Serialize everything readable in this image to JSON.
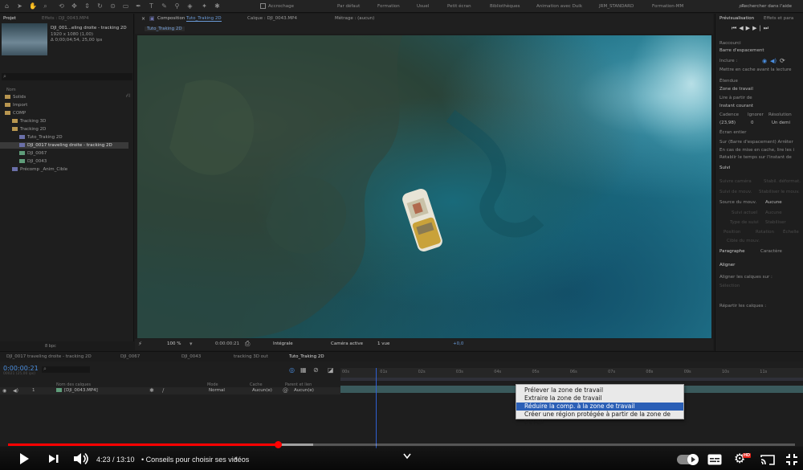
{
  "toolbar": {
    "snap_label": "Accrochage",
    "workspaces": [
      "Par défaut",
      "Formation",
      "Usuel",
      "Petit écran",
      "Bibliothèques",
      "Animation avec Duik",
      "JRM_STANDARD",
      "Formation-MM"
    ],
    "search_help": "Rechercher dans l'aide"
  },
  "project": {
    "tab_project": "Projet",
    "tab_effects": "Effets : DJI_0043.MP4",
    "selected_name": "DJI_001...eling droite - tracking 2D",
    "selected_dims": "1920 x 1080 (1,00)",
    "selected_duration": "Δ 0;00;04;54, 25,00 ips",
    "column_name": "Nom",
    "items": [
      {
        "label": "Solids",
        "kind": "folder",
        "indent": 0
      },
      {
        "label": "Import",
        "kind": "folder",
        "indent": 0
      },
      {
        "label": "COMP",
        "kind": "folder",
        "indent": 0
      },
      {
        "label": "Tracking 3D",
        "kind": "folder",
        "indent": 1
      },
      {
        "label": "Tracking 2D",
        "kind": "folder",
        "indent": 1
      },
      {
        "label": "Tuto_Traking 2D",
        "kind": "comp",
        "indent": 2
      },
      {
        "label": "DJI_0017 traveling droite - tracking 2D",
        "kind": "comp",
        "indent": 2
      },
      {
        "label": "DJI_0067",
        "kind": "footage",
        "indent": 2
      },
      {
        "label": "DJI_0043",
        "kind": "footage",
        "indent": 2
      },
      {
        "label": "Précomp _Anim_Cible",
        "kind": "comp",
        "indent": 1
      }
    ],
    "bpc": "8 bpc"
  },
  "viewer": {
    "tab_composition": "Composition",
    "tab_composition_name": "Tuto_Traking 2D",
    "tab_layer": "Calque : DJI_0043.MP4",
    "tab_footage": "Métrage : (aucun)",
    "breadcrumb": "Tuto_Traking 2D",
    "zoom": "100 %",
    "timecode": "0:00:00:21",
    "resolution": "Intégrale",
    "camera": "Caméra active",
    "views": "1 vue",
    "exposure": "+0,0"
  },
  "right": {
    "preview_tab": "Prévisualisation",
    "effects_tab": "Effets et para",
    "shortcut_label": "Raccourci",
    "shortcut_value": "Barre d'espacement",
    "include_label": "Inclure :",
    "cache_label": "Mettre en cache avant la lecture",
    "range_label": "Étendue",
    "range_value": "Zone de travail",
    "play_from_label": "Lire à partir de",
    "play_from_value": "Instant courant",
    "fps_label": "Cadence",
    "skip_label": "Ignorer",
    "res_label": "Résolution",
    "fps_value": "(23,98)",
    "skip_value": "0",
    "res_value": "Un demi",
    "fullscreen_label": "Écran entier",
    "stop_label": "Sur (Barre d'espacement) Arrêter",
    "stop_cache": "En cas de mise en cache, lire les i",
    "stop_time": "Rétablir le temps sur l'instant de",
    "track_tab": "Suivi",
    "track_camera": "Suivre caméra",
    "stab_warp": "Stabil. déformat.",
    "track_motion": "Suivi de mouv.",
    "stab_motion": "Stabiliser le mouv.",
    "motion_source_label": "Source du mouv.",
    "motion_source_value": "Aucune",
    "current_track": "Suivi actuel",
    "current_track_value": "Aucune",
    "track_type": "Type de suivi",
    "track_type_value": "Stabiliser",
    "opt_position": "Position",
    "opt_rotation": "Rotation",
    "opt_scale": "Échelle",
    "motion_target": "Cible du mouv.",
    "paragraph_tab": "Paragraphe",
    "character_tab": "Caractère",
    "align_tab": "Aligner",
    "align_layers_label": "Aligner les calques sur :",
    "align_selection": "Sélection",
    "distribute_label": "Répartir les calques :"
  },
  "timeline": {
    "tabs": [
      "DJI_0017 traveling droite - tracking 2D",
      "DJI_0067",
      "DJI_0043",
      "tracking 3D out",
      "Tuto_Traking 2D"
    ],
    "active_tab_index": 4,
    "timecode": "0:00:00:21",
    "timecode_sub": "00021 (25,00 ips)",
    "col_layer_name": "Nom des calques",
    "col_mode": "Mode",
    "col_trkmat": "Cache",
    "col_parent": "Parent et lien",
    "ruler_labels": [
      "00s",
      "01s",
      "02s",
      "03s",
      "04s",
      "05s",
      "06s",
      "07s",
      "08s",
      "09s",
      "10s",
      "11s"
    ],
    "layer": {
      "index": "1",
      "name": "[DJI_0043.MP4]",
      "mode": "Normal",
      "trkmat": "Aucun(e)",
      "parent": "Aucun(e)"
    }
  },
  "context_menu": {
    "items": [
      "Prélever la zone de travail",
      "Extraire la zone de travail",
      "Réduire la comp. à la zone de travail",
      "Créer une région protégée à partir de la zone de travail"
    ],
    "selected_index": 2
  },
  "youtube": {
    "time": "4:23 / 13:10",
    "chapter": "• Conseils pour choisir ses vidéos",
    "hd_badge": "HD",
    "progress_played": 0.343,
    "progress_buffered": 0.388
  }
}
